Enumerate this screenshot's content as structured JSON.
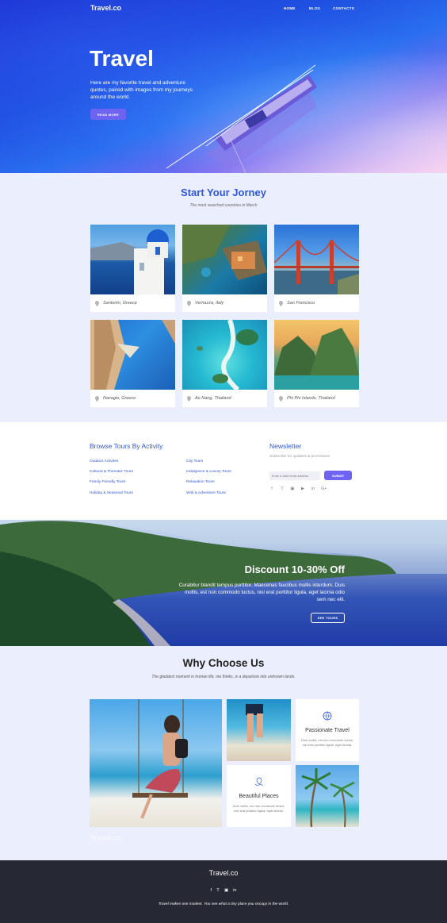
{
  "header": {
    "brand": "Travel.co",
    "nav": [
      "HOME",
      "BLOG",
      "CONTACTS"
    ]
  },
  "hero": {
    "title": "Travel",
    "text": "Here are my favorite travel and adventure quotes, paired with images from my journeys around the world.",
    "button": "READ MORE"
  },
  "journey": {
    "title": "Start Your Jorney",
    "subtitle": "The most searched countries in March",
    "places": [
      "Santorini, Greece",
      "Vernazza, Italy",
      "San Francisco",
      "Navagio, Greece",
      "Ao Nang, Thailand",
      "Phi Phi Islands, Thailand"
    ]
  },
  "browse": {
    "title": "Browse Tours By Activity",
    "links_left": [
      "Outdoor Activites",
      "Cultural & Thematic Tours",
      "Family Friendly Tours",
      "Holiday & Seasonal Tours"
    ],
    "links_right": [
      "City Tours",
      "Indulgence & Luxury Tours",
      "Relaxation Tours",
      "Wild & Adventure Tours"
    ]
  },
  "newsletter": {
    "title": "Newsletter",
    "subtitle": "Subscribe for updates & promotions",
    "placeholder": "Enter a valid email address",
    "button": "SUBMIT",
    "social_icons": [
      "facebook-icon",
      "twitter-icon",
      "instagram-icon",
      "youtube-icon",
      "linkedin-icon",
      "google-plus-icon"
    ]
  },
  "discount": {
    "title": "Discount 10-30% Off",
    "text": "Curabitur blandit tempus porttitor. Maecenas faucibus mollis interdum. Duis mollis, est non commodo luctus, nisi erat porttitor ligula, eget lacinia odio sem nec elit.",
    "button": "SEE TOURS"
  },
  "why": {
    "title": "Why Choose Us",
    "subtitle": "The gladdest moment in human life, me thinks, is a departure into unknown lands.",
    "features": [
      {
        "title": "Passionate Travel",
        "text": "Duis mollis, est non commodo luctus, nisi erat porttitor ligula, eget lacinia."
      },
      {
        "title": "Beautiful Places",
        "text": "Duis mollis, est non commodo luctus, nisi erat porttitor ligula, eget lacinia."
      }
    ],
    "watermark": "Travel.co"
  },
  "footer": {
    "brand": "Travel.co",
    "social_icons": [
      "facebook-icon",
      "twitter-icon",
      "instagram-icon",
      "linkedin-icon"
    ],
    "text": "Travel makes one modest. You see what a tiny place you occupy in the world."
  },
  "colors": {
    "accent": "#6f63f2",
    "link": "#2f58d6",
    "section_bg": "#ebeefc",
    "footer_bg": "#262833"
  }
}
